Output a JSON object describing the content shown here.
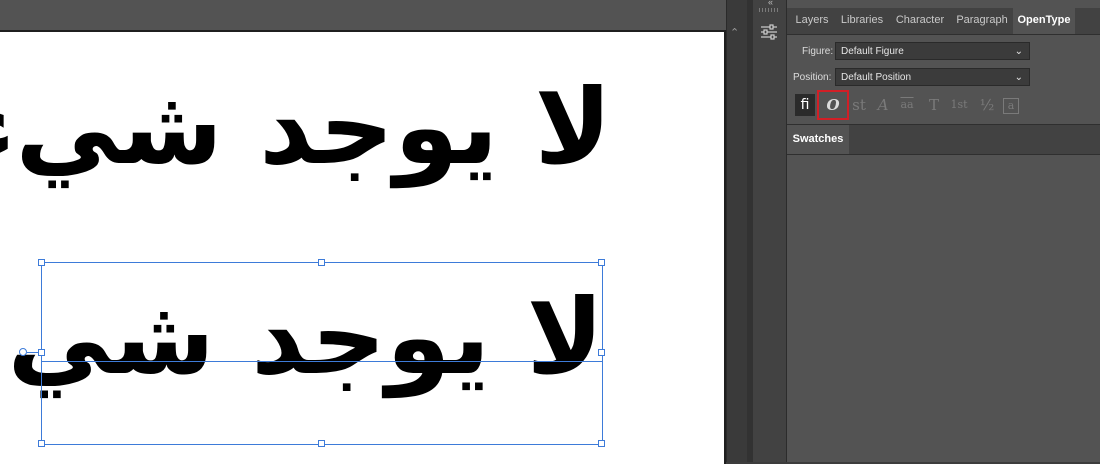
{
  "document": {
    "text_line_1": "لا يوجد شيء",
    "text_line_2": "لا يوجد شيء"
  },
  "panel": {
    "tabs": [
      {
        "label": "Layers"
      },
      {
        "label": "Libraries"
      },
      {
        "label": "Character"
      },
      {
        "label": "Paragraph"
      },
      {
        "label": "OpenType",
        "active": true
      }
    ],
    "figure": {
      "label": "Figure:",
      "value": "Default Figure"
    },
    "position": {
      "label": "Position:",
      "value": "Default Position"
    },
    "buttons": [
      {
        "name": "standard-ligatures",
        "glyph": "fi"
      },
      {
        "name": "swash",
        "glyph": "O"
      },
      {
        "name": "discretionary-ligatures",
        "glyph": "st"
      },
      {
        "name": "contextual-alternates",
        "glyph": "A"
      },
      {
        "name": "stylistic-alternates",
        "glyph": "aa"
      },
      {
        "name": "titling-alternates",
        "glyph": "T"
      },
      {
        "name": "ordinals",
        "glyph": "1st"
      },
      {
        "name": "fractions",
        "glyph": "½"
      },
      {
        "name": "stylistic-sets",
        "glyph": "a"
      }
    ]
  },
  "swatches": {
    "tab_label": "Swatches"
  },
  "colors": {
    "highlight": "#d21f26",
    "selection": "#3d7bd9"
  }
}
